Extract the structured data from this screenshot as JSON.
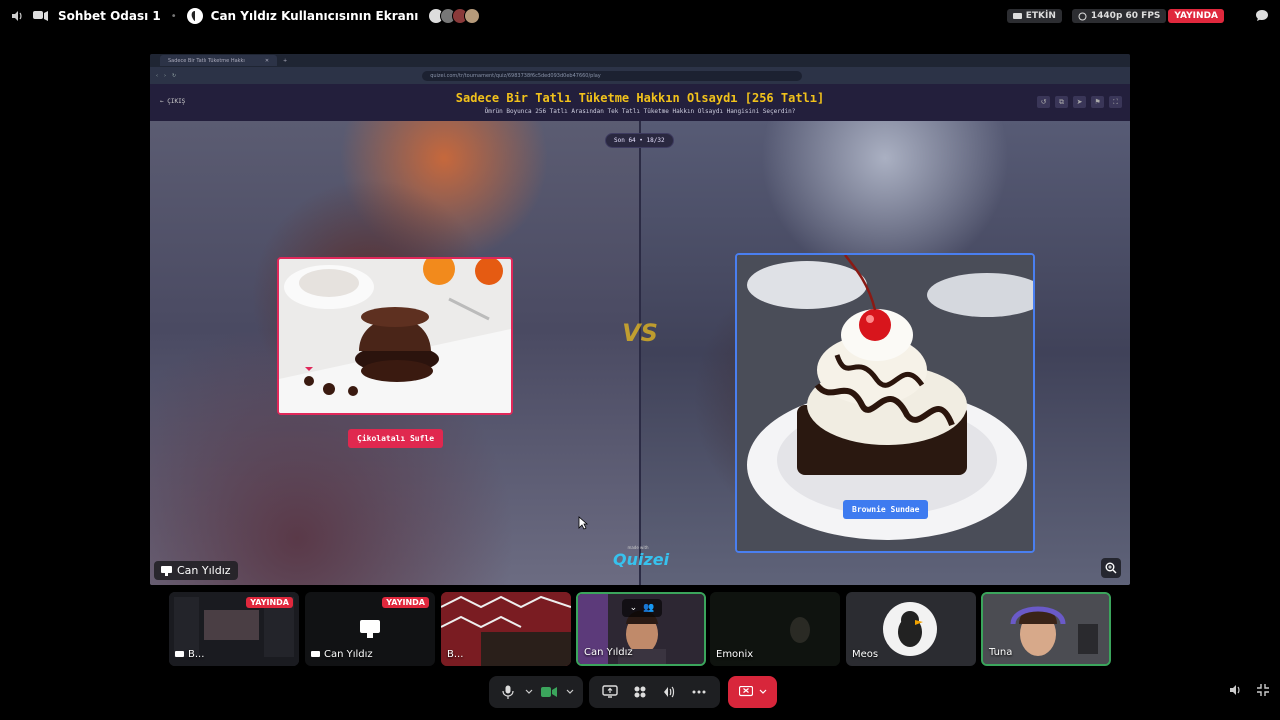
{
  "topbar": {
    "channel_name": "Sohbet Odası 1",
    "stream_title": "Can Yıldız Kullanıcısının Ekranı",
    "status_pill": "ETKİN",
    "quality": "1440p 60 FPS",
    "live_badge": "YAYINDA"
  },
  "browser": {
    "tab_title": "Sadece Bir Tatlı Tüketme Hakkı",
    "url": "quizei.com/tr/tournament/quiz/6983738f6c5ded093d0eb47660/play"
  },
  "quiz": {
    "exit_label": "ÇIKIŞ",
    "title": "Sadece Bir Tatlı Tüketme Hakkın Olsaydı [256 Tatlı]",
    "subtitle": "Ömrün Boyunca 256 Tatlı Arasından Tek Tatlı Tüketme Hakkın Olsaydı Hangisini Seçerdin?",
    "round": "Son 64 • 18/32",
    "vs": "VS",
    "left_option": "Çikolatalı Sufle",
    "right_option": "Brownie Sundae",
    "made_with": "made with",
    "brand": "Quizei"
  },
  "stream_owner_tag": "Can Yıldız",
  "participants": [
    {
      "name": "B...",
      "live": "YAYINDA"
    },
    {
      "name": "Can Yıldız",
      "live": "YAYINDA"
    },
    {
      "name": "B..."
    },
    {
      "name": "Can Yıldız"
    },
    {
      "name": "Emonix"
    },
    {
      "name": "Meos"
    },
    {
      "name": "Tuna"
    }
  ],
  "colors": {
    "accent_red": "#e0283d",
    "quiz_yellow": "#f2c21b",
    "left_border": "#e0285a",
    "right_border": "#4a7ff0",
    "speaking_green": "#3ba55c"
  }
}
